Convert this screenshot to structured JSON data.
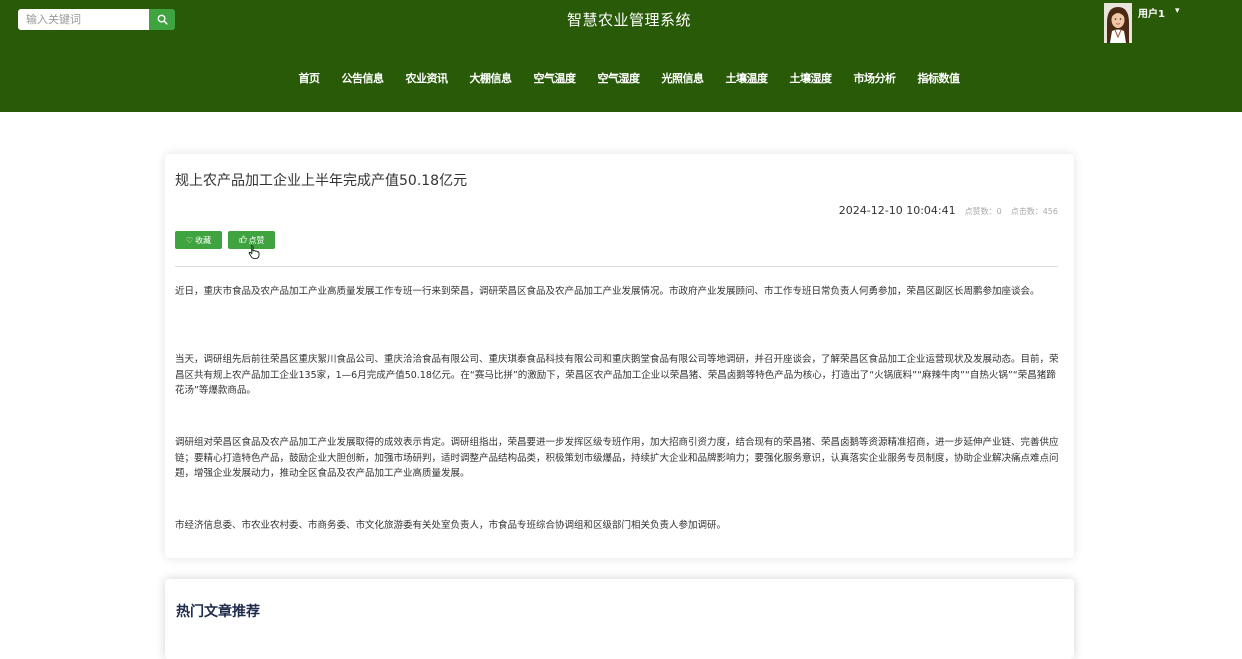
{
  "header": {
    "search": {
      "placeholder": "输入关键词"
    },
    "site_title": "智慧农业管理系统",
    "user": {
      "name": "用户1",
      "caret": "▾"
    },
    "nav": [
      "首页",
      "公告信息",
      "农业资讯",
      "大棚信息",
      "空气温度",
      "空气湿度",
      "光照信息",
      "土壤温度",
      "土壤湿度",
      "市场分析",
      "指标数值"
    ]
  },
  "article": {
    "title": "规上农产品加工企业上半年完成产值50.18亿元",
    "datetime": "2024-12-10 10:04:41",
    "likes_label": "点赞数：",
    "likes": "0",
    "clicks_label": "点击数：",
    "clicks": "456",
    "favorite_label": "收藏",
    "like_label": "点赞",
    "paragraphs": [
      "近日，重庆市食品及农产品加工产业高质量发展工作专班一行来到荣昌，调研荣昌区食品及农产品加工产业发展情况。市政府产业发展顾问、市工作专班日常负责人何勇参加，荣昌区副区长周鹏参加座谈会。",
      "当天，调研组先后前往荣昌区重庆絮川食品公司、重庆洽洽食品有限公司、重庆琪泰食品科技有限公司和重庆鹅堂食品有限公司等地调研，并召开座谈会，了解荣昌区食品加工企业运营现状及发展动态。目前，荣昌区共有规上农产品加工企业135家，1—6月完成产值50.18亿元。在“赛马比拼”的激励下，荣昌区农产品加工企业以荣昌猪、荣昌卤鹅等特色产品为核心，打造出了“火锅底料”“麻辣牛肉”“自热火锅”“荣昌猪蹄花汤”等爆款商品。",
      "调研组对荣昌区食品及农产品加工产业发展取得的成效表示肯定。调研组指出，荣昌要进一步发挥区级专班作用，加大招商引资力度，结合现有的荣昌猪、荣昌卤鹅等资源精准招商，进一步延伸产业链、完善供应链；要精心打造特色产品，鼓励企业大胆创新，加强市场研判，适时调整产品结构品类，积极策划市级爆品，持续扩大企业和品牌影响力；要强化服务意识，认真落实企业服务专员制度，协助企业解决痛点难点问题，增强企业发展动力，推动全区食品及农产品加工产业高质量发展。",
      "市经济信息委、市农业农村委、市商务委、市文化旅游委有关处室负责人，市食品专班综合协调组和区级部门相关负责人参加调研。"
    ]
  },
  "hot": {
    "title": "热门文章推荐"
  },
  "colors": {
    "header_bg": "#285a08",
    "accent_green": "#3fa33f",
    "heading_navy": "#1e2a4a"
  }
}
